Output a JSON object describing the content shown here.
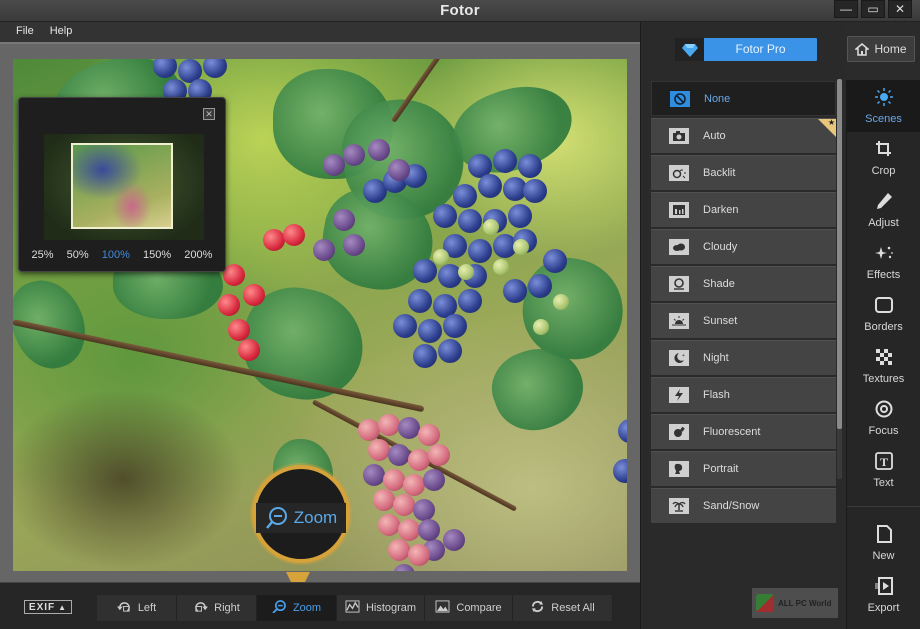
{
  "window": {
    "title": "Fotor",
    "controls": [
      {
        "name": "minimize",
        "glyph": "—"
      },
      {
        "name": "maximize",
        "glyph": "▭"
      },
      {
        "name": "close",
        "glyph": "✕"
      }
    ]
  },
  "menu": [
    "File",
    "Help"
  ],
  "navigator": {
    "close_glyph": "✕",
    "zoom_levels": [
      "25%",
      "50%",
      "100%",
      "150%",
      "200%"
    ],
    "active_zoom": "100%"
  },
  "callout": {
    "label": "Zoom",
    "icon": "zoom-out-icon"
  },
  "bottom_toolbar": {
    "exif_label": "EXIF",
    "tools": [
      {
        "label": "Left",
        "icon": "rotate-left-icon",
        "active": false
      },
      {
        "label": "Right",
        "icon": "rotate-right-icon",
        "active": false
      },
      {
        "label": "Zoom",
        "icon": "zoom-icon",
        "active": true
      },
      {
        "label": "Histogram",
        "icon": "histogram-icon",
        "active": false
      },
      {
        "label": "Compare",
        "icon": "compare-icon",
        "active": false
      },
      {
        "label": "Reset All",
        "icon": "reset-icon",
        "active": false
      }
    ]
  },
  "pro_button": {
    "label": "Fotor Pro",
    "icon": "diamond-icon"
  },
  "home_button": {
    "label": "Home",
    "icon": "home-icon"
  },
  "scenes": [
    {
      "label": "None",
      "icon": "none-icon",
      "selected": true
    },
    {
      "label": "Auto",
      "icon": "camera-icon",
      "pro": true
    },
    {
      "label": "Backlit",
      "icon": "backlit-icon"
    },
    {
      "label": "Darken",
      "icon": "darken-icon"
    },
    {
      "label": "Cloudy",
      "icon": "cloud-icon"
    },
    {
      "label": "Shade",
      "icon": "shade-icon"
    },
    {
      "label": "Sunset",
      "icon": "sunset-icon"
    },
    {
      "label": "Night",
      "icon": "moon-icon"
    },
    {
      "label": "Flash",
      "icon": "flash-icon"
    },
    {
      "label": "Fluorescent",
      "icon": "bulb-icon"
    },
    {
      "label": "Portrait",
      "icon": "portrait-icon"
    },
    {
      "label": "Sand/Snow",
      "icon": "palm-icon"
    }
  ],
  "side_tools": [
    {
      "label": "Scenes",
      "icon": "scenes-icon",
      "active": true
    },
    {
      "label": "Crop",
      "icon": "crop-icon"
    },
    {
      "label": "Adjust",
      "icon": "pencil-icon"
    },
    {
      "label": "Effects",
      "icon": "sparkle-icon"
    },
    {
      "label": "Borders",
      "icon": "border-icon"
    },
    {
      "label": "Textures",
      "icon": "texture-icon"
    },
    {
      "label": "Focus",
      "icon": "focus-icon"
    },
    {
      "label": "Text",
      "icon": "text-icon"
    }
  ],
  "file_tools": [
    {
      "label": "New",
      "icon": "new-file-icon"
    },
    {
      "label": "Export",
      "icon": "export-icon"
    }
  ],
  "watermark": {
    "text": "ALL PC World"
  },
  "colors": {
    "accent": "#3a93e6",
    "callout": "#d6a23a",
    "pro_flag": "#e8c77a"
  }
}
